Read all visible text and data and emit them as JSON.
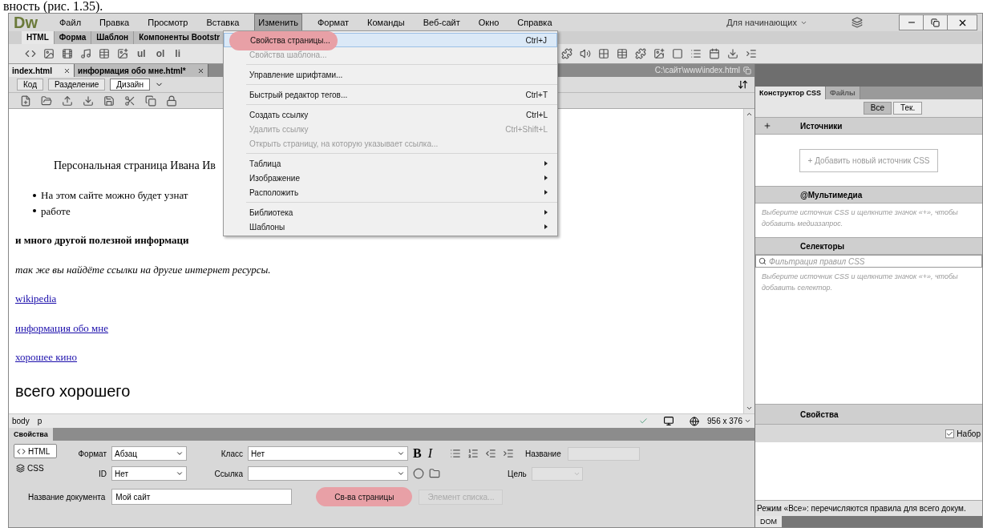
{
  "caption": "вность (рис. 1.35).",
  "logo": "Dw",
  "menu": [
    {
      "label": "Файл",
      "selected": false
    },
    {
      "label": "Правка",
      "selected": false
    },
    {
      "label": "Просмотр",
      "selected": false
    },
    {
      "label": "Вставка",
      "selected": false
    },
    {
      "label": "Изменить",
      "selected": true
    },
    {
      "label": "Формат",
      "selected": false
    },
    {
      "label": "Команды",
      "selected": false
    },
    {
      "label": "Веб-сайт",
      "selected": false
    },
    {
      "label": "Окно",
      "selected": false
    },
    {
      "label": "Справка",
      "selected": false
    }
  ],
  "workspace": "Для начинающих",
  "insert_tabs": [
    {
      "label": "HTML",
      "selected": true
    },
    {
      "label": "Форма",
      "selected": false
    },
    {
      "label": "Шаблон",
      "selected": false
    },
    {
      "label": "Компоненты Bootstr",
      "selected": false
    }
  ],
  "insert_text_buttons": [
    "ul",
    "ol",
    "li"
  ],
  "doc_tabs": [
    {
      "label": "index.html",
      "selected": true
    },
    {
      "label": "информация обо мне.html*",
      "selected": false
    }
  ],
  "doc_path": "C:\\сайт\\www\\index.html",
  "views": [
    {
      "label": "Код",
      "selected": false
    },
    {
      "label": "Разделение",
      "selected": false
    },
    {
      "label": "Дизайн",
      "selected": true
    }
  ],
  "page": [
    {
      "kind": "indent",
      "text": "Персональная страница Ивана Ив"
    },
    {
      "kind": "bullet",
      "text": "На этом сайте можно будет узнат"
    },
    {
      "kind": "bullet",
      "text": "работе"
    },
    {
      "kind": "bold",
      "text": "и много другой полезной информаци"
    },
    {
      "kind": "italic",
      "text": "так же вы найдёте ссылки на другие интернет ресурсы."
    },
    {
      "kind": "link",
      "text": "wikipedia"
    },
    {
      "kind": "link",
      "text": "информация обо мне"
    },
    {
      "kind": "link",
      "text": "хорошее кино"
    },
    {
      "kind": "large",
      "text": "всего хорошего"
    }
  ],
  "edit_menu": [
    {
      "kind": "item",
      "label": "Свойства страницы...",
      "shortcut": "Ctrl+J",
      "disabled": false,
      "submenu": false,
      "selected": true,
      "highlighted": true
    },
    {
      "kind": "item",
      "label": "Свойства шаблона...",
      "disabled": true,
      "submenu": false,
      "selected": false,
      "highlighted": false
    },
    {
      "kind": "separator"
    },
    {
      "kind": "item",
      "label": "Управление шрифтами...",
      "disabled": false,
      "submenu": false,
      "selected": false,
      "highlighted": false
    },
    {
      "kind": "separator"
    },
    {
      "kind": "item",
      "label": "Быстрый редактор тегов...",
      "shortcut": "Ctrl+T",
      "disabled": false,
      "submenu": false,
      "selected": false,
      "highlighted": false
    },
    {
      "kind": "separator"
    },
    {
      "kind": "item",
      "label": "Создать ссылку",
      "shortcut": "Ctrl+L",
      "disabled": false,
      "submenu": false,
      "selected": false,
      "highlighted": false
    },
    {
      "kind": "item",
      "label": "Удалить ссылку",
      "shortcut": "Ctrl+Shift+L",
      "disabled": true,
      "submenu": false,
      "selected": false,
      "highlighted": false
    },
    {
      "kind": "item",
      "label": "Открыть страницу, на которую указывает ссылка...",
      "disabled": true,
      "submenu": false,
      "selected": false,
      "highlighted": false
    },
    {
      "kind": "separator"
    },
    {
      "kind": "item",
      "label": "Таблица",
      "disabled": false,
      "submenu": true,
      "selected": false,
      "highlighted": false
    },
    {
      "kind": "item",
      "label": "Изображение",
      "disabled": false,
      "submenu": true,
      "selected": false,
      "highlighted": false
    },
    {
      "kind": "item",
      "label": "Расположить",
      "disabled": false,
      "submenu": true,
      "selected": false,
      "highlighted": false
    },
    {
      "kind": "separator"
    },
    {
      "kind": "item",
      "label": "Библиотека",
      "disabled": false,
      "submenu": true,
      "selected": false,
      "highlighted": false
    },
    {
      "kind": "item",
      "label": "Шаблоны",
      "disabled": false,
      "submenu": true,
      "selected": false,
      "highlighted": false
    }
  ],
  "tag_selector": [
    "body",
    "p"
  ],
  "window_size": "956 x 376",
  "properties": {
    "title": "Свойства",
    "modes": [
      {
        "label": "HTML",
        "selected": true
      },
      {
        "label": "CSS",
        "selected": false
      }
    ],
    "format_label": "Формат",
    "format": "Абзац",
    "class_label": "Класс",
    "class": "Нет",
    "id_label": "ID",
    "id": "Нет",
    "link_label": "Ссылка",
    "bold": "B",
    "italic": "I",
    "title_label": "Название",
    "target_label": "Цель",
    "doc_title_label": "Название документа",
    "doc_title": "Мой сайт",
    "buttons": [
      {
        "label": "Св-ва страницы",
        "disabled": false,
        "highlighted": true
      },
      {
        "label": "Элемент списка...",
        "disabled": true,
        "highlighted": false
      }
    ]
  },
  "css_designer": {
    "tabs": [
      {
        "label": "Конструктор CSS",
        "selected": true
      },
      {
        "label": "Файлы",
        "selected": false
      }
    ],
    "filters": [
      {
        "label": "Все",
        "selected": true
      },
      {
        "label": "Тек.",
        "selected": false
      }
    ],
    "sources_title": "Источники",
    "add_source": "+ Добавить новый источник CSS",
    "media_title": "@Мультимедиа",
    "media_hint": "Выберите источник CSS и щелкните значок «+», чтобы добавить медиазапрос.",
    "selectors_title": "Селекторы",
    "selectors_placeholder": "Фильтрация правил CSS",
    "selectors_hint": "Выберите источник CSS и щелкните значок «+», чтобы добавить селектор.",
    "props_title": "Свойства",
    "set_label": "Набор",
    "set_checked": true,
    "footer": "Режим «Все»: перечисляются правила для всего докум.",
    "bottom_tab": "DOM"
  }
}
